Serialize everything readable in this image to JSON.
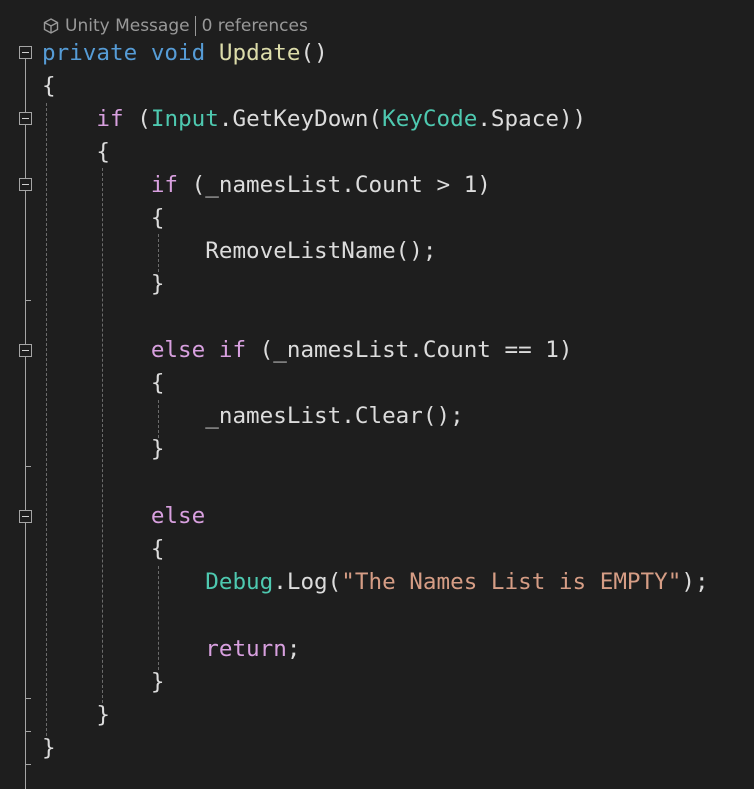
{
  "codelens": {
    "icon": "cube-icon",
    "message": "Unity Message",
    "references": "0 references"
  },
  "code": {
    "l1": {
      "kw1": "private",
      "kw2": "void",
      "name": "Update",
      "rest": "()"
    },
    "l2": {
      "text": "{"
    },
    "l3": {
      "kw": "if",
      "p1": " (",
      "cls": "Input",
      "p2": ".GetKeyDown(",
      "cls2": "KeyCode",
      "p3": ".Space))"
    },
    "l4": {
      "text": "{"
    },
    "l5": {
      "kw": "if",
      "rest": " (_namesList.Count > 1)"
    },
    "l6": {
      "text": "{"
    },
    "l7": {
      "text": "RemoveListName();"
    },
    "l8": {
      "text": "}"
    },
    "l10": {
      "kw": "else if",
      "rest": " (_namesList.Count == 1)"
    },
    "l11": {
      "text": "{"
    },
    "l12": {
      "text": "_namesList.Clear();"
    },
    "l13": {
      "text": "}"
    },
    "l15": {
      "kw": "else"
    },
    "l16": {
      "text": "{"
    },
    "l17": {
      "cls": "Debug",
      "p1": ".Log(",
      "str": "\"The Names List is EMPTY\"",
      "p2": ");"
    },
    "l19": {
      "kw": "return",
      "p": ";"
    },
    "l20": {
      "text": "}"
    },
    "l21": {
      "text": "}"
    },
    "l22": {
      "text": "}"
    }
  },
  "colors": {
    "background": "#1e1e1e",
    "keyword": "#569cd6",
    "control_keyword": "#d8a0df",
    "class_name": "#4ec9b0",
    "string": "#d69d85",
    "identifier": "#dcdcdc",
    "codelens": "#999999"
  }
}
